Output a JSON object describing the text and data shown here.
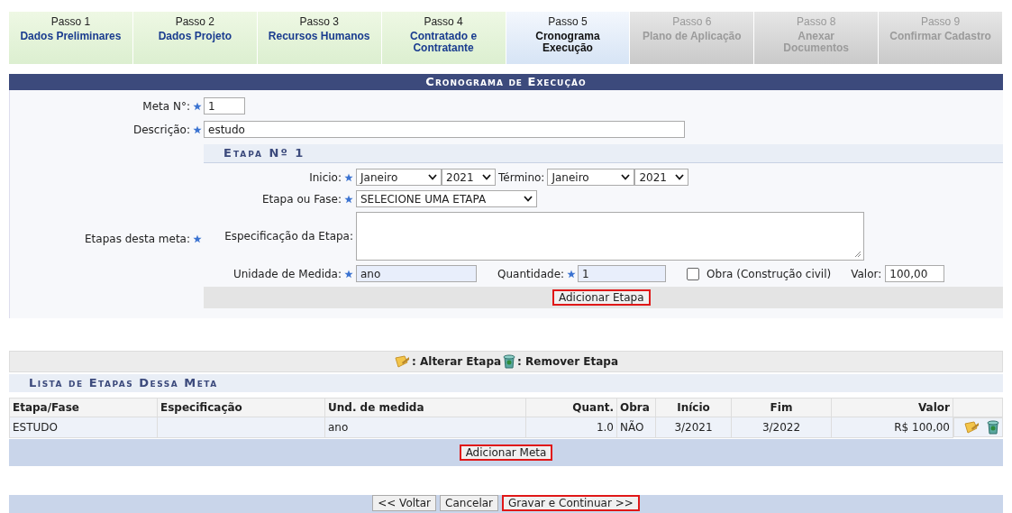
{
  "steps": [
    {
      "label": "Passo 1",
      "title": "Dados Preliminares",
      "selected": false,
      "disabled": false
    },
    {
      "label": "Passo 2",
      "title": "Dados Projeto",
      "selected": false,
      "disabled": false
    },
    {
      "label": "Passo 3",
      "title": "Recursos Humanos",
      "selected": false,
      "disabled": false
    },
    {
      "label": "Passo 4",
      "title": "Contratado e Contratante",
      "selected": false,
      "disabled": false
    },
    {
      "label": "Passo 5",
      "title": "Cronograma Execução",
      "selected": true,
      "disabled": false
    },
    {
      "label": "Passo 6",
      "title": "Plano de Aplicação",
      "selected": false,
      "disabled": true
    },
    {
      "label": "Passo 8",
      "title": "Anexar Documentos",
      "selected": false,
      "disabled": true
    },
    {
      "label": "Passo 9",
      "title": "Confirmar Cadastro",
      "selected": false,
      "disabled": true
    }
  ],
  "form": {
    "title": "Cronograma de Execução",
    "meta_no": {
      "label": "Meta N°:",
      "required": true,
      "value": "1"
    },
    "descricao": {
      "label": "Descrição:",
      "required": true,
      "value": "estudo"
    },
    "etapas_label": {
      "label": "Etapas desta meta:",
      "required": true
    },
    "etapa": {
      "title": "Etapa Nº 1",
      "inicio": {
        "label": "Inicio:",
        "required": true,
        "month": "Janeiro",
        "year": "2021"
      },
      "termino": {
        "label": "Término:",
        "required": false,
        "month": "Janeiro",
        "year": "2021"
      },
      "etapa_fase": {
        "label": "Etapa ou Fase:",
        "required": true,
        "value": "SELECIONE UMA ETAPA"
      },
      "especificacao": {
        "label": "Especificação da Etapa:",
        "required": false
      },
      "unidade": {
        "label": "Unidade de Medida:",
        "required": true,
        "value": "ano"
      },
      "quantidade": {
        "label": "Quantidade:",
        "required": true,
        "value": "1"
      },
      "obra": {
        "label": "Obra (Construção civil)",
        "checked": false
      },
      "valor": {
        "label": "Valor:",
        "required": false,
        "value": "100,00"
      },
      "add_button": {
        "label": "Adicionar Etapa",
        "highlighted": true
      }
    }
  },
  "legend": [
    {
      "kind": "edit",
      "text": ": Alterar Etapa"
    },
    {
      "kind": "delete",
      "text": ": Remover Etapa"
    }
  ],
  "list": {
    "title": "Lista de Etapas Dessa Meta",
    "columns": [
      "Etapa/Fase",
      "Especificação",
      "Und. de medida",
      "Quant.",
      "Obra",
      "Início",
      "Fim",
      "Valor"
    ],
    "rows": [
      {
        "cells": [
          "ESTUDO",
          "",
          "ano",
          "1.0",
          "NÃO",
          "3/2021",
          "3/2022",
          "R$ 100,00"
        ],
        "actions": [
          {
            "kind": "edit"
          },
          {
            "kind": "delete"
          }
        ]
      }
    ],
    "add_button": {
      "label": "Adicionar Meta",
      "highlighted": true
    }
  },
  "footer_buttons": [
    {
      "label": "<< Voltar",
      "highlighted": false
    },
    {
      "label": "Cancelar",
      "highlighted": false
    },
    {
      "label": "Gravar e Continuar >>",
      "highlighted": true
    }
  ]
}
